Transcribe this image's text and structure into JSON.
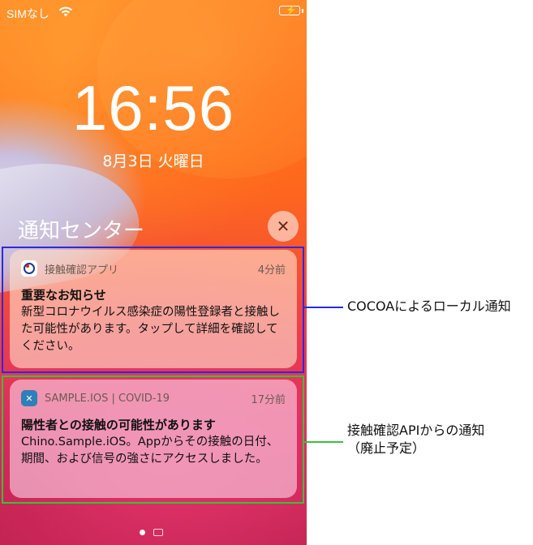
{
  "status_bar": {
    "carrier": "SIMなし",
    "battery_color": "#4cd964"
  },
  "lock_screen": {
    "time": "16:56",
    "date": "8月3日 火曜日"
  },
  "notification_center": {
    "title": "通知センター",
    "close_symbol": "✕"
  },
  "notifications": [
    {
      "app": "接触確認アプリ",
      "ago": "4分前",
      "title": "重要なお知らせ",
      "body": "新型コロナウイルス感染症の陽性登録者と接触した可能性があります。タップして詳細を確認してください。"
    },
    {
      "app": "SAMPLE.IOS | COVID-19",
      "ago": "17分前",
      "title": "陽性者との接触の可能性があります",
      "body": "Chino.Sample.iOS。Appからその接触の日付、期間、および信号の強さにアクセスしました。"
    }
  ],
  "annotations": {
    "cocoa": "COCOAによるローカル通知",
    "api_line1": "接触確認APIからの通知",
    "api_line2": "（廃止予定）",
    "blue": "#2a2ae0",
    "green": "#3cbf3c"
  }
}
